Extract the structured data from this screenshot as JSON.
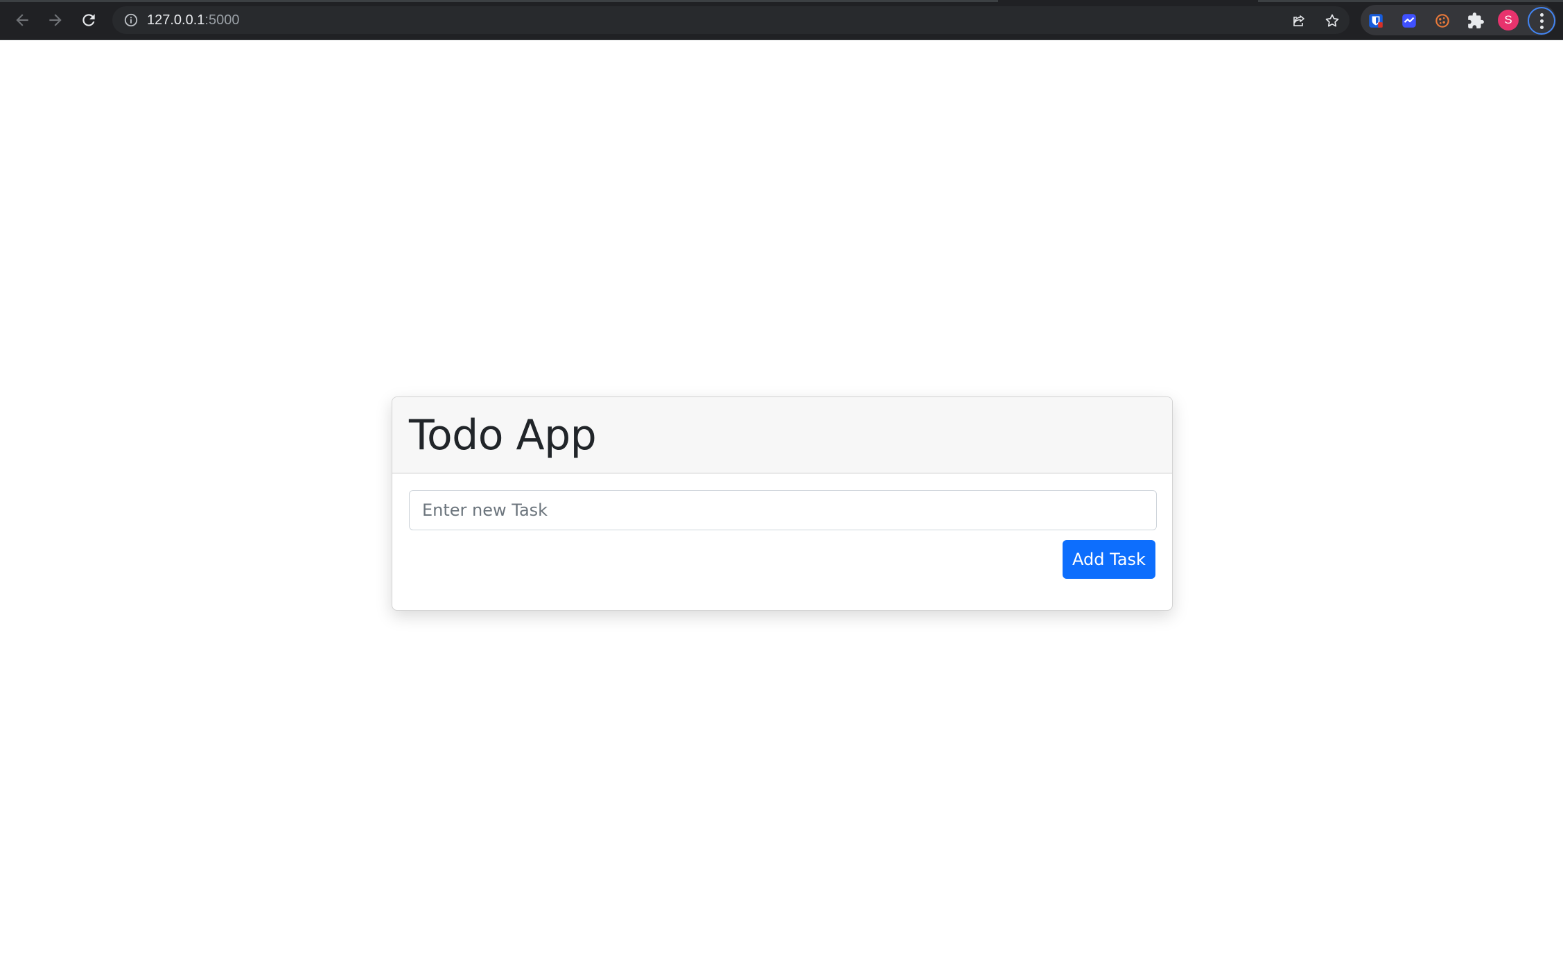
{
  "browser": {
    "url_host": "127.0.0.1",
    "url_port": ":5000",
    "avatar_letter": "S",
    "extensions": [
      "bitwarden-icon",
      "extension-chart-icon",
      "cookie-icon",
      "puzzle-icon"
    ]
  },
  "app": {
    "title": "Todo App",
    "input_placeholder": "Enter new Task",
    "input_value": "",
    "add_button_label": "Add Task"
  },
  "colors": {
    "primary": "#0d6efd",
    "header_bg": "#f7f7f7",
    "chrome_bg": "#202124",
    "avatar": "#e8336d"
  }
}
